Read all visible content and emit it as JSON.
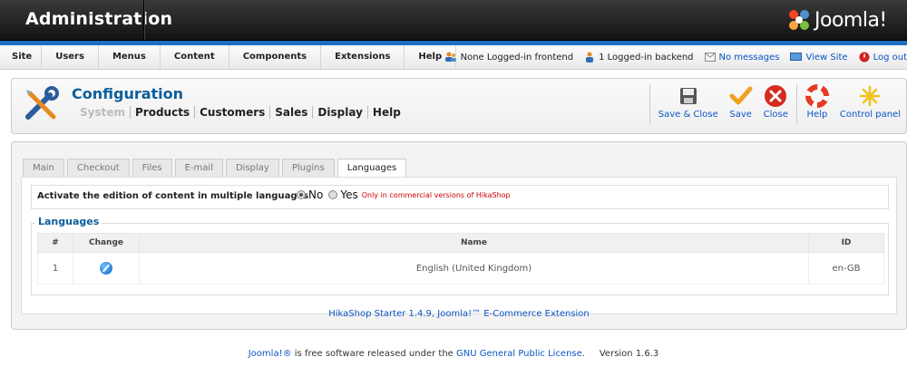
{
  "header": {
    "title": "Administration",
    "brand": "Joomla!"
  },
  "menu": [
    "Site",
    "Users",
    "Menus",
    "Content",
    "Components",
    "Extensions",
    "Help"
  ],
  "status": {
    "frontend": "None Logged-in frontend",
    "backend": "1 Logged-in backend",
    "messages": "No messages",
    "view_site": "View Site",
    "logout": "Log out"
  },
  "toolbar": {
    "title": "Configuration",
    "subnav": [
      "System",
      "Products",
      "Customers",
      "Sales",
      "Display",
      "Help"
    ],
    "buttons": {
      "save_close": "Save & Close",
      "save": "Save",
      "close": "Close",
      "help": "Help",
      "control_panel": "Control panel"
    }
  },
  "tabs": [
    "Main",
    "Checkout",
    "Files",
    "E-mail",
    "Display",
    "Plugins",
    "Languages"
  ],
  "active_tab": "Languages",
  "multilang": {
    "label": "Activate the edition of content in multiple languages",
    "no": "No",
    "yes": "Yes",
    "selected": "No",
    "note": "Only in commercial versions of HikaShop"
  },
  "languages": {
    "legend": "Languages",
    "columns": [
      "#",
      "Change",
      "Name",
      "ID"
    ],
    "rows": [
      {
        "num": "1",
        "name": "English (United Kingdom)",
        "id": "en-GB"
      }
    ]
  },
  "extension_footer": "HikaShop Starter 1.4.9, Joomla!™ E-Commerce Extension",
  "footer": {
    "joomla": "Joomla!®",
    "text1": " is free software released under the ",
    "license": "GNU General Public License",
    "text2": ".     Version 1.6.3"
  },
  "colors": {
    "accent": "#0b5e9c",
    "link": "#0b55c4",
    "header_bg": "#1a1a1a",
    "strip": "#1f6fbf",
    "note": "#cc0000"
  }
}
